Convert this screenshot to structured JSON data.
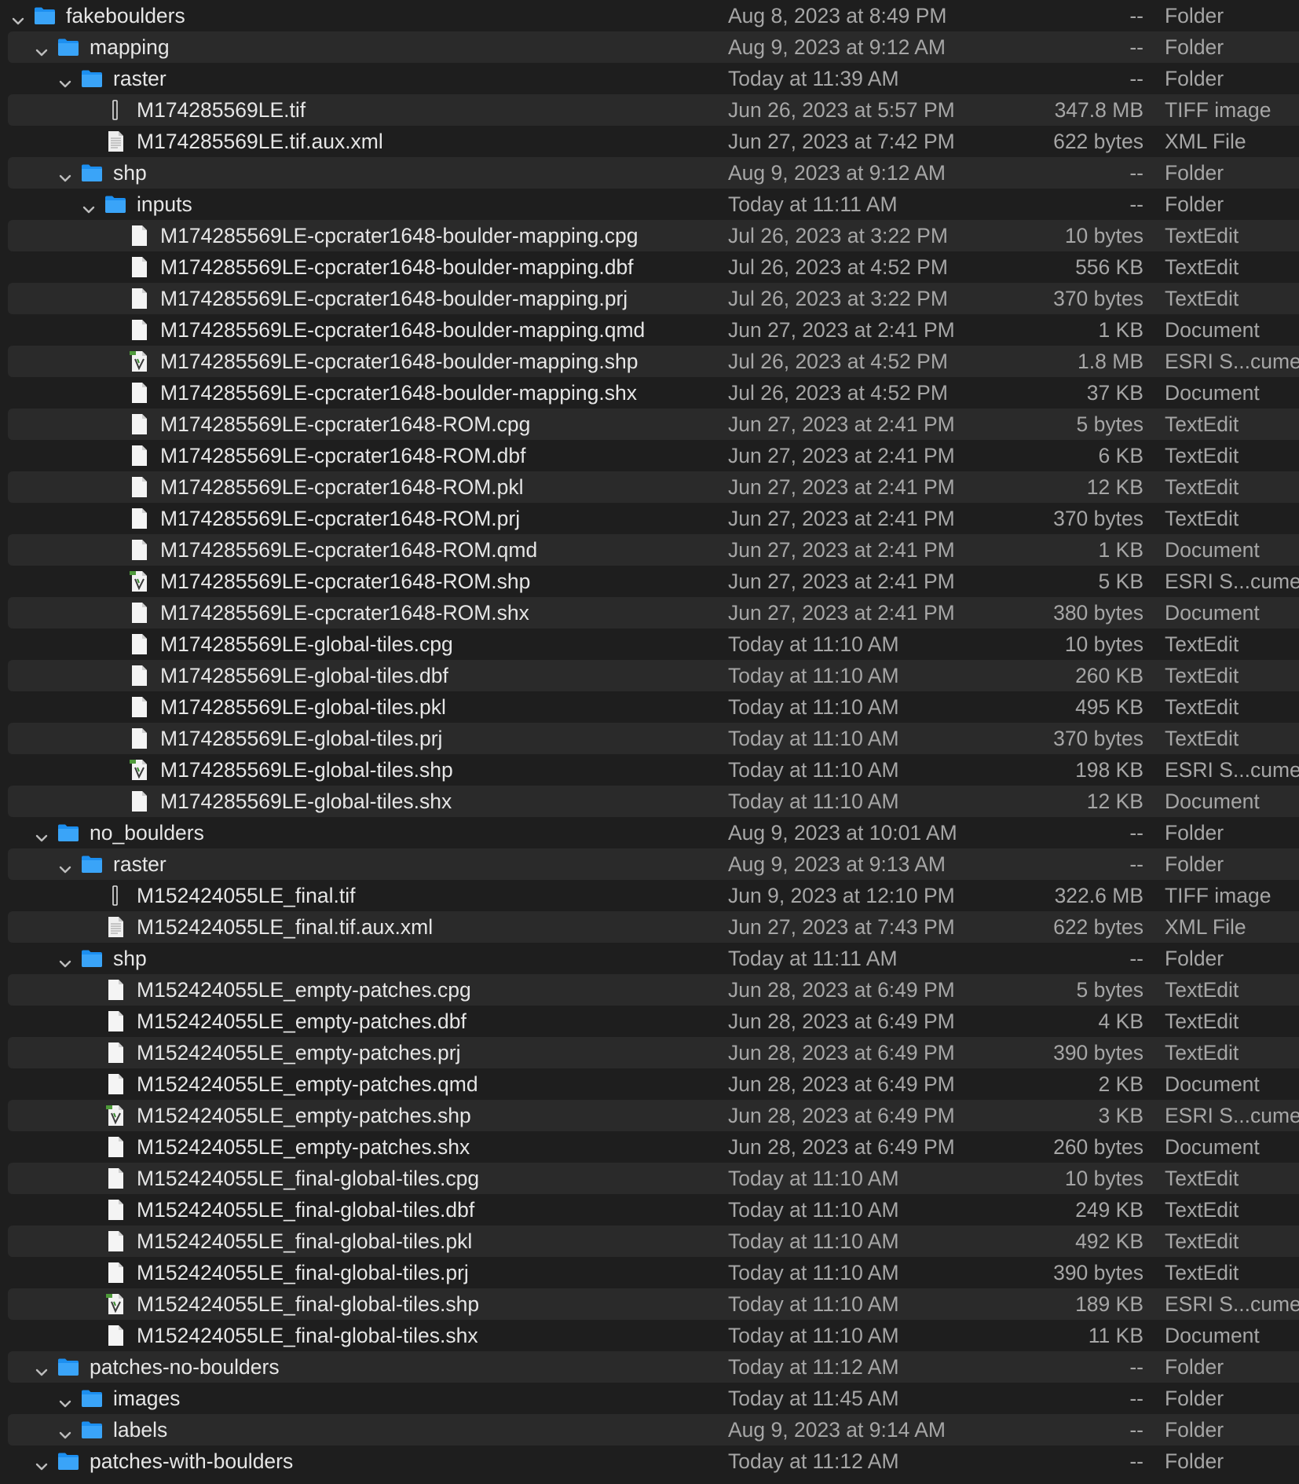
{
  "rows": [
    {
      "name": "fakeboulders",
      "date": "Aug 8, 2023 at 8:49 PM",
      "size": "--",
      "kind": "Folder",
      "type": "folder",
      "depth": 0,
      "expanded": true
    },
    {
      "name": "mapping",
      "date": "Aug 9, 2023 at 9:12 AM",
      "size": "--",
      "kind": "Folder",
      "type": "folder",
      "depth": 1,
      "expanded": true
    },
    {
      "name": "raster",
      "date": "Today at 11:39 AM",
      "size": "--",
      "kind": "Folder",
      "type": "folder",
      "depth": 2,
      "expanded": true
    },
    {
      "name": "M174285569LE.tif",
      "date": "Jun 26, 2023 at 5:57 PM",
      "size": "347.8 MB",
      "kind": "TIFF image",
      "type": "tiff",
      "depth": 3
    },
    {
      "name": "M174285569LE.tif.aux.xml",
      "date": "Jun 27, 2023 at 7:42 PM",
      "size": "622 bytes",
      "kind": "XML File",
      "type": "xml",
      "depth": 3
    },
    {
      "name": "shp",
      "date": "Aug 9, 2023 at 9:12 AM",
      "size": "--",
      "kind": "Folder",
      "type": "folder",
      "depth": 2,
      "expanded": true
    },
    {
      "name": "inputs",
      "date": "Today at 11:11 AM",
      "size": "--",
      "kind": "Folder",
      "type": "folder",
      "depth": 3,
      "expanded": true
    },
    {
      "name": "M174285569LE-cpcrater1648-boulder-mapping.cpg",
      "date": "Jul 26, 2023 at 3:22 PM",
      "size": "10 bytes",
      "kind": "TextEdit",
      "type": "doc",
      "depth": 4
    },
    {
      "name": "M174285569LE-cpcrater1648-boulder-mapping.dbf",
      "date": "Jul 26, 2023 at 4:52 PM",
      "size": "556 KB",
      "kind": "TextEdit",
      "type": "doc",
      "depth": 4
    },
    {
      "name": "M174285569LE-cpcrater1648-boulder-mapping.prj",
      "date": "Jul 26, 2023 at 3:22 PM",
      "size": "370 bytes",
      "kind": "TextEdit",
      "type": "doc",
      "depth": 4
    },
    {
      "name": "M174285569LE-cpcrater1648-boulder-mapping.qmd",
      "date": "Jun 27, 2023 at 2:41 PM",
      "size": "1 KB",
      "kind": "Document",
      "type": "doc",
      "depth": 4
    },
    {
      "name": "M174285569LE-cpcrater1648-boulder-mapping.shp",
      "date": "Jul 26, 2023 at 4:52 PM",
      "size": "1.8 MB",
      "kind": "ESRI S...cumen",
      "type": "shp",
      "depth": 4
    },
    {
      "name": "M174285569LE-cpcrater1648-boulder-mapping.shx",
      "date": "Jul 26, 2023 at 4:52 PM",
      "size": "37 KB",
      "kind": "Document",
      "type": "doc",
      "depth": 4
    },
    {
      "name": "M174285569LE-cpcrater1648-ROM.cpg",
      "date": "Jun 27, 2023 at 2:41 PM",
      "size": "5 bytes",
      "kind": "TextEdit",
      "type": "doc",
      "depth": 4
    },
    {
      "name": "M174285569LE-cpcrater1648-ROM.dbf",
      "date": "Jun 27, 2023 at 2:41 PM",
      "size": "6 KB",
      "kind": "TextEdit",
      "type": "doc",
      "depth": 4
    },
    {
      "name": "M174285569LE-cpcrater1648-ROM.pkl",
      "date": "Jun 27, 2023 at 2:41 PM",
      "size": "12 KB",
      "kind": "TextEdit",
      "type": "doc",
      "depth": 4
    },
    {
      "name": "M174285569LE-cpcrater1648-ROM.prj",
      "date": "Jun 27, 2023 at 2:41 PM",
      "size": "370 bytes",
      "kind": "TextEdit",
      "type": "doc",
      "depth": 4
    },
    {
      "name": "M174285569LE-cpcrater1648-ROM.qmd",
      "date": "Jun 27, 2023 at 2:41 PM",
      "size": "1 KB",
      "kind": "Document",
      "type": "doc",
      "depth": 4
    },
    {
      "name": "M174285569LE-cpcrater1648-ROM.shp",
      "date": "Jun 27, 2023 at 2:41 PM",
      "size": "5 KB",
      "kind": "ESRI S...cumen",
      "type": "shp",
      "depth": 4
    },
    {
      "name": "M174285569LE-cpcrater1648-ROM.shx",
      "date": "Jun 27, 2023 at 2:41 PM",
      "size": "380 bytes",
      "kind": "Document",
      "type": "doc",
      "depth": 4
    },
    {
      "name": "M174285569LE-global-tiles.cpg",
      "date": "Today at 11:10 AM",
      "size": "10 bytes",
      "kind": "TextEdit",
      "type": "doc",
      "depth": 4
    },
    {
      "name": "M174285569LE-global-tiles.dbf",
      "date": "Today at 11:10 AM",
      "size": "260 KB",
      "kind": "TextEdit",
      "type": "doc",
      "depth": 4
    },
    {
      "name": "M174285569LE-global-tiles.pkl",
      "date": "Today at 11:10 AM",
      "size": "495 KB",
      "kind": "TextEdit",
      "type": "doc",
      "depth": 4
    },
    {
      "name": "M174285569LE-global-tiles.prj",
      "date": "Today at 11:10 AM",
      "size": "370 bytes",
      "kind": "TextEdit",
      "type": "doc",
      "depth": 4
    },
    {
      "name": "M174285569LE-global-tiles.shp",
      "date": "Today at 11:10 AM",
      "size": "198 KB",
      "kind": "ESRI S...cumen",
      "type": "shp",
      "depth": 4
    },
    {
      "name": "M174285569LE-global-tiles.shx",
      "date": "Today at 11:10 AM",
      "size": "12 KB",
      "kind": "Document",
      "type": "doc",
      "depth": 4
    },
    {
      "name": "no_boulders",
      "date": "Aug 9, 2023 at 10:01 AM",
      "size": "--",
      "kind": "Folder",
      "type": "folder",
      "depth": 1,
      "expanded": true
    },
    {
      "name": "raster",
      "date": "Aug 9, 2023 at 9:13 AM",
      "size": "--",
      "kind": "Folder",
      "type": "folder",
      "depth": 2,
      "expanded": true
    },
    {
      "name": "M152424055LE_final.tif",
      "date": "Jun 9, 2023 at 12:10 PM",
      "size": "322.6 MB",
      "kind": "TIFF image",
      "type": "tiff",
      "depth": 3
    },
    {
      "name": "M152424055LE_final.tif.aux.xml",
      "date": "Jun 27, 2023 at 7:43 PM",
      "size": "622 bytes",
      "kind": "XML File",
      "type": "xml",
      "depth": 3
    },
    {
      "name": "shp",
      "date": "Today at 11:11 AM",
      "size": "--",
      "kind": "Folder",
      "type": "folder",
      "depth": 2,
      "expanded": true
    },
    {
      "name": "M152424055LE_empty-patches.cpg",
      "date": "Jun 28, 2023 at 6:49 PM",
      "size": "5 bytes",
      "kind": "TextEdit",
      "type": "doc",
      "depth": 3
    },
    {
      "name": "M152424055LE_empty-patches.dbf",
      "date": "Jun 28, 2023 at 6:49 PM",
      "size": "4 KB",
      "kind": "TextEdit",
      "type": "doc",
      "depth": 3
    },
    {
      "name": "M152424055LE_empty-patches.prj",
      "date": "Jun 28, 2023 at 6:49 PM",
      "size": "390 bytes",
      "kind": "TextEdit",
      "type": "doc",
      "depth": 3
    },
    {
      "name": "M152424055LE_empty-patches.qmd",
      "date": "Jun 28, 2023 at 6:49 PM",
      "size": "2 KB",
      "kind": "Document",
      "type": "doc",
      "depth": 3
    },
    {
      "name": "M152424055LE_empty-patches.shp",
      "date": "Jun 28, 2023 at 6:49 PM",
      "size": "3 KB",
      "kind": "ESRI S...cumen",
      "type": "shp",
      "depth": 3
    },
    {
      "name": "M152424055LE_empty-patches.shx",
      "date": "Jun 28, 2023 at 6:49 PM",
      "size": "260 bytes",
      "kind": "Document",
      "type": "doc",
      "depth": 3
    },
    {
      "name": "M152424055LE_final-global-tiles.cpg",
      "date": "Today at 11:10 AM",
      "size": "10 bytes",
      "kind": "TextEdit",
      "type": "doc",
      "depth": 3
    },
    {
      "name": "M152424055LE_final-global-tiles.dbf",
      "date": "Today at 11:10 AM",
      "size": "249 KB",
      "kind": "TextEdit",
      "type": "doc",
      "depth": 3
    },
    {
      "name": "M152424055LE_final-global-tiles.pkl",
      "date": "Today at 11:10 AM",
      "size": "492 KB",
      "kind": "TextEdit",
      "type": "doc",
      "depth": 3
    },
    {
      "name": "M152424055LE_final-global-tiles.prj",
      "date": "Today at 11:10 AM",
      "size": "390 bytes",
      "kind": "TextEdit",
      "type": "doc",
      "depth": 3
    },
    {
      "name": "M152424055LE_final-global-tiles.shp",
      "date": "Today at 11:10 AM",
      "size": "189 KB",
      "kind": "ESRI S...cumen",
      "type": "shp",
      "depth": 3
    },
    {
      "name": "M152424055LE_final-global-tiles.shx",
      "date": "Today at 11:10 AM",
      "size": "11 KB",
      "kind": "Document",
      "type": "doc",
      "depth": 3
    },
    {
      "name": "patches-no-boulders",
      "date": "Today at 11:12 AM",
      "size": "--",
      "kind": "Folder",
      "type": "folder",
      "depth": 1,
      "expanded": true
    },
    {
      "name": "images",
      "date": "Today at 11:45 AM",
      "size": "--",
      "kind": "Folder",
      "type": "folder",
      "depth": 2,
      "expanded": true
    },
    {
      "name": "labels",
      "date": "Aug 9, 2023 at 9:14 AM",
      "size": "--",
      "kind": "Folder",
      "type": "folder",
      "depth": 2,
      "expanded": true
    },
    {
      "name": "patches-with-boulders",
      "date": "Today at 11:12 AM",
      "size": "--",
      "kind": "Folder",
      "type": "folder",
      "depth": 1,
      "expanded": true
    }
  ]
}
